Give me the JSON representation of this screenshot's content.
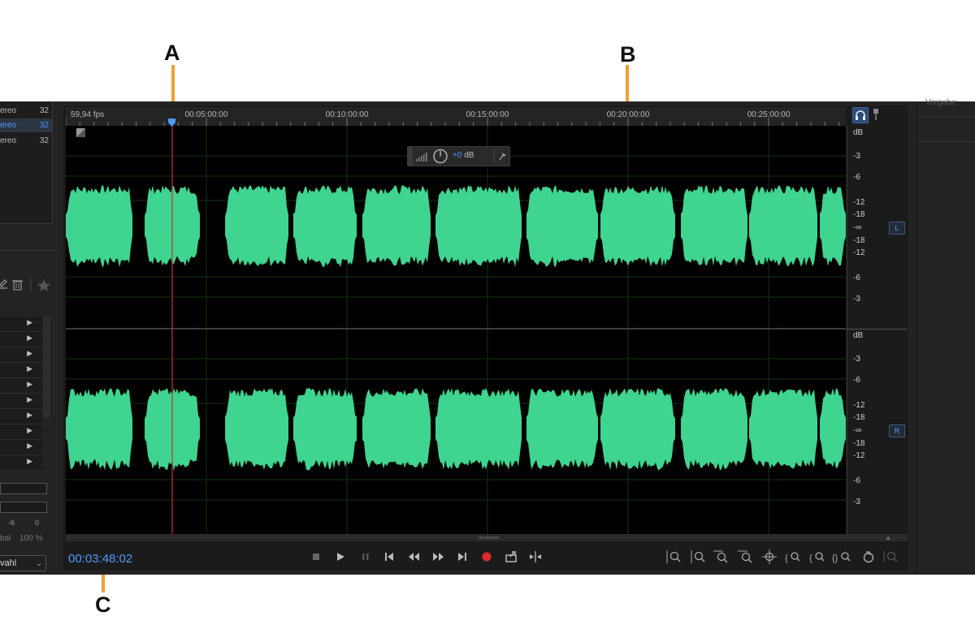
{
  "app": {
    "left_panel": {
      "tracks": [
        {
          "name": "ereo",
          "bits": "32",
          "selected": false
        },
        {
          "name": "ereo",
          "bits": "32",
          "selected": true
        },
        {
          "name": "ereo",
          "bits": "32",
          "selected": false
        }
      ],
      "meter_scale": [
        "-6",
        "0"
      ],
      "balance_label": "bal",
      "balance_value": "100 %",
      "selection_dropdown": "vahl"
    },
    "editor": {
      "fps": "59,94 fps",
      "ruler_labels": [
        "00:05:00:00",
        "00:10:00:00",
        "00:15:00:00",
        "00:20:00:00",
        "00:25:00:00"
      ],
      "hud": {
        "gain_value": "+0",
        "gain_unit": "dB"
      },
      "db_scale_top": [
        "dB",
        "-3",
        "-6",
        "-12",
        "-18",
        "-∞",
        "-18",
        "-12",
        "-6",
        "-3"
      ],
      "db_scale_bottom": [
        "dB",
        "-3",
        "-6",
        "-12",
        "-18",
        "-∞",
        "-18",
        "-12",
        "-6",
        "-3"
      ],
      "channel_left": "L",
      "channel_right": "R",
      "waveform_color": "#3fd48f",
      "playhead_color": "#d03030"
    },
    "transport": {
      "timecode": "00:03:48:02",
      "record_color": "#e02b2b"
    },
    "right_panel": {
      "label": "Vorgabe:"
    }
  },
  "callouts": {
    "a": "A",
    "b": "B",
    "c": "C"
  },
  "accent_color": "#4f9bff",
  "callout_color": "#f0a030"
}
